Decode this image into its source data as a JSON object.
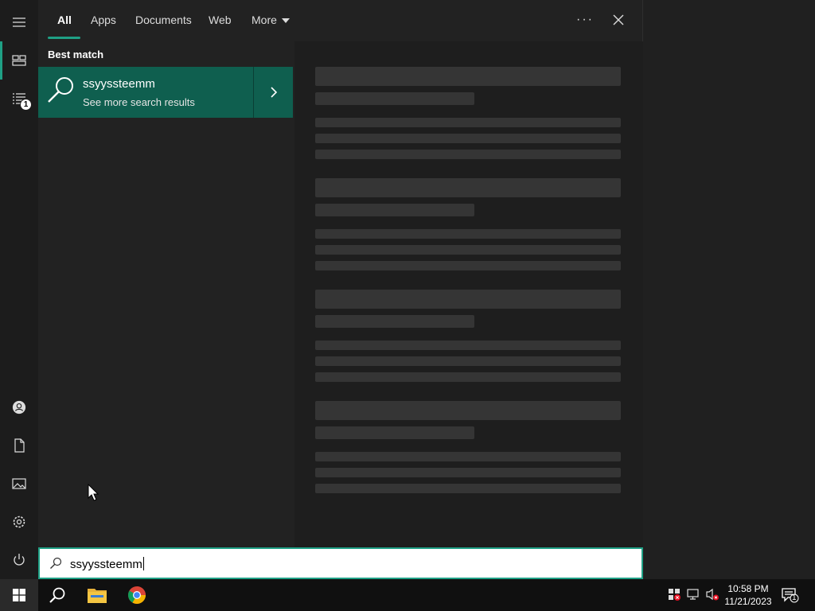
{
  "tabs": [
    {
      "label": "All",
      "active": true
    },
    {
      "label": "Apps"
    },
    {
      "label": "Documents"
    },
    {
      "label": "Web"
    },
    {
      "label": "More"
    }
  ],
  "best_match": {
    "section_label": "Best match",
    "title": "ssyyssteemm",
    "subtitle": "See more search results"
  },
  "search": {
    "value": "ssyyssteemm"
  },
  "rail": {
    "badge_count": "1"
  },
  "taskbar": {
    "time": "10:58 PM",
    "date": "11/21/2023",
    "notification_count": "1"
  },
  "icons": [
    "menu-icon",
    "home-icon",
    "documents-list-icon",
    "account-icon",
    "document-icon",
    "pictures-icon",
    "settings-icon",
    "power-icon",
    "start-icon",
    "search-icon",
    "file-explorer-icon",
    "chrome-icon",
    "defender-icon",
    "network-icon",
    "volume-muted-icon",
    "action-center-icon"
  ],
  "colors": {
    "accent": "#1fa085",
    "best_match_bg": "#0f5f4f"
  }
}
